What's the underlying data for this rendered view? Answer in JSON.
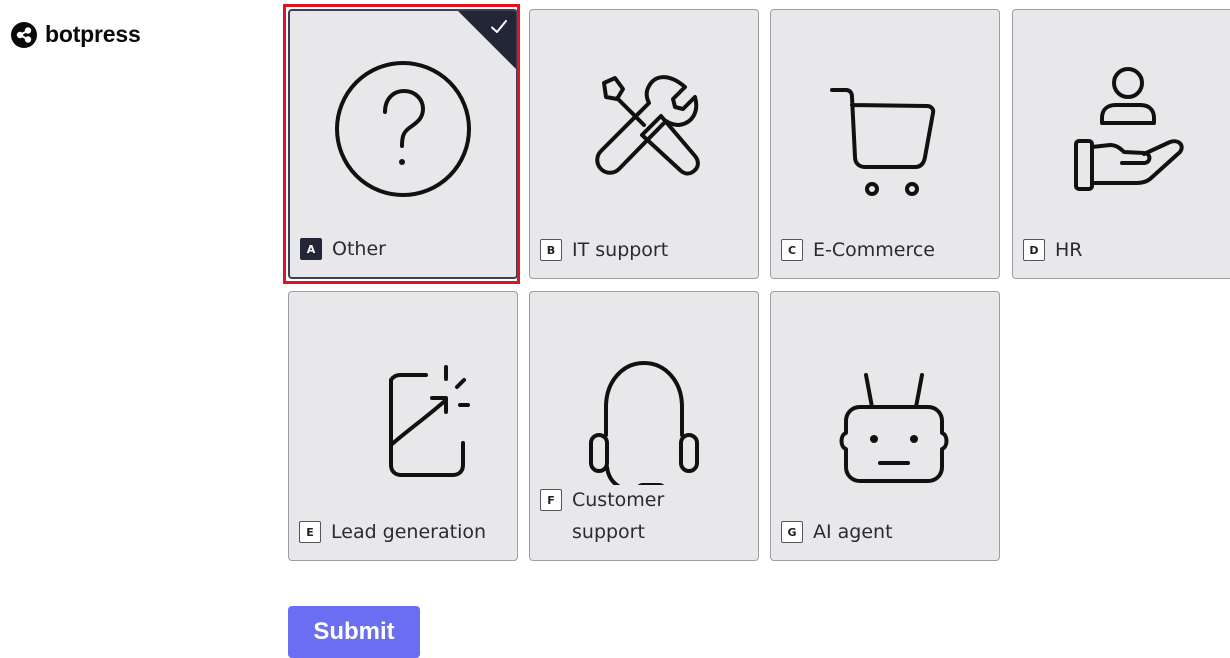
{
  "brand": {
    "name": "botpress",
    "logo_icon": "botpress-logo-icon"
  },
  "options": [
    {
      "key": "A",
      "label": "Other",
      "icon": "question-circle-icon",
      "selected": true
    },
    {
      "key": "B",
      "label": "IT support",
      "icon": "tools-icon",
      "selected": false
    },
    {
      "key": "C",
      "label": "E-Commerce",
      "icon": "shopping-cart-icon",
      "selected": false
    },
    {
      "key": "D",
      "label": "HR",
      "icon": "hand-person-icon",
      "selected": false
    },
    {
      "key": "E",
      "label": "Lead generation",
      "icon": "lead-arrow-icon",
      "selected": false
    },
    {
      "key": "F",
      "label": "Customer support",
      "icon": "headset-icon",
      "selected": false
    },
    {
      "key": "G",
      "label": "AI agent",
      "icon": "robot-icon",
      "selected": false
    }
  ],
  "submit_label": "Submit",
  "colors": {
    "selected_dark": "#232637",
    "highlight_red": "#e0141e",
    "submit_bg": "#6a6ef0",
    "card_bg": "#e8e8ea"
  }
}
